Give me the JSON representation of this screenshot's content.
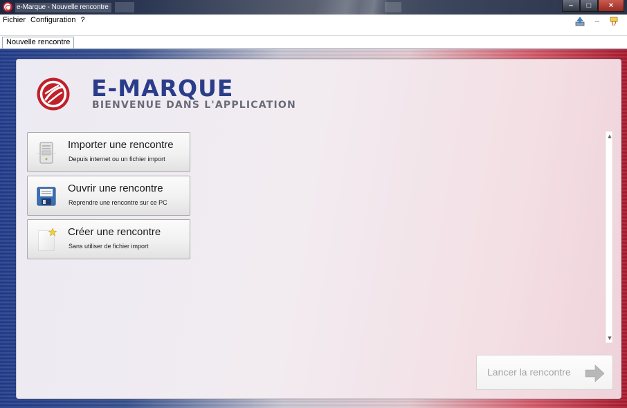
{
  "window": {
    "title": "e-Marque - Nouvelle rencontre"
  },
  "menu": {
    "items": [
      "Fichier",
      "Configuration",
      "?"
    ],
    "right_separator": "--"
  },
  "tabs": [
    {
      "label": "Nouvelle rencontre",
      "active": true
    }
  ],
  "brand": {
    "title": "E-MARQUE",
    "subtitle": "BIENVENUE DANS L'APPLICATION",
    "logo_color": "#c0202a",
    "title_color": "#2b3d8a"
  },
  "actions": [
    {
      "label": "Importer une rencontre",
      "description": "Depuis internet ou un fichier import",
      "icon": "computer-tower-icon"
    },
    {
      "label": "Ouvrir une rencontre",
      "description": "Reprendre une rencontre sur ce PC",
      "icon": "floppy-disk-icon"
    },
    {
      "label": "Créer une rencontre",
      "description": "Sans utiliser de fichier import",
      "icon": "new-document-icon"
    }
  ],
  "launch": {
    "label": "Lancer la rencontre",
    "enabled": false,
    "icon": "arrow-right-icon"
  }
}
